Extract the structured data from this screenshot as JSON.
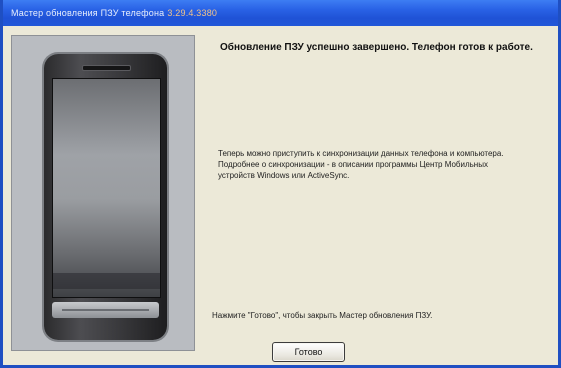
{
  "window": {
    "title": "Мастер обновления ПЗУ телефона",
    "version": "3.29.4.3380"
  },
  "main": {
    "heading": "Обновление ПЗУ успешно завершено. Телефон готов к работе.",
    "info_text": "Теперь можно приступить к синхронизации данных телефона и компьютера. Подробнее о синхронизации - в описании программы Центр Мобильных устройств Windows или ActiveSync.",
    "finish_hint": "Нажмите \"Готово\", чтобы закрыть Мастер обновления ПЗУ.",
    "finish_button_label": "Готово"
  },
  "illustration": {
    "icon": "smartphone-image"
  }
}
